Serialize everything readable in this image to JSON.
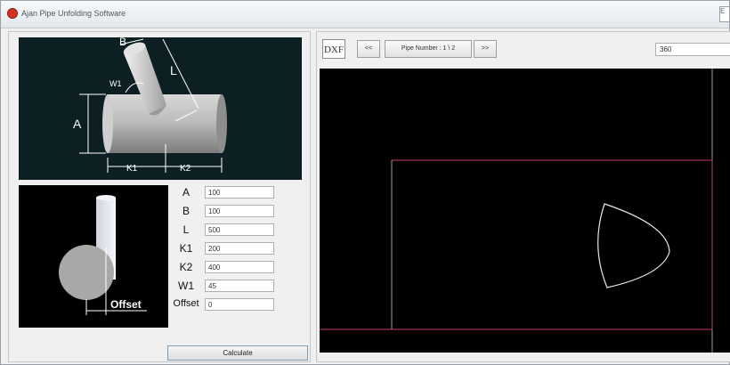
{
  "window": {
    "title": "Ajan Pipe Unfolding Software",
    "corner_button": "E"
  },
  "diagram_top": {
    "labels": {
      "B": "B",
      "W1": "W1",
      "L": "L",
      "A": "A",
      "K1": "K1",
      "K2": "K2"
    }
  },
  "diagram_side": {
    "offset_label": "Offset"
  },
  "params": [
    {
      "label": "A",
      "value": "100"
    },
    {
      "label": "B",
      "value": "100"
    },
    {
      "label": "L",
      "value": "500"
    },
    {
      "label": "K1",
      "value": "200"
    },
    {
      "label": "K2",
      "value": "400"
    },
    {
      "label": "W1",
      "value": "45"
    },
    {
      "label": "Offset",
      "value": "0"
    }
  ],
  "calculate_label": "Calculate",
  "toolbar": {
    "dxf_label": "DXF",
    "prev_label": "<<",
    "pipe_number_label": "Pipe Number : 1 \\ 2",
    "next_label": ">>",
    "angle_value": "360"
  },
  "colors": {
    "canvas_bg": "#000000",
    "frame_line": "#c04060",
    "shape_line": "#e8e8e8"
  }
}
